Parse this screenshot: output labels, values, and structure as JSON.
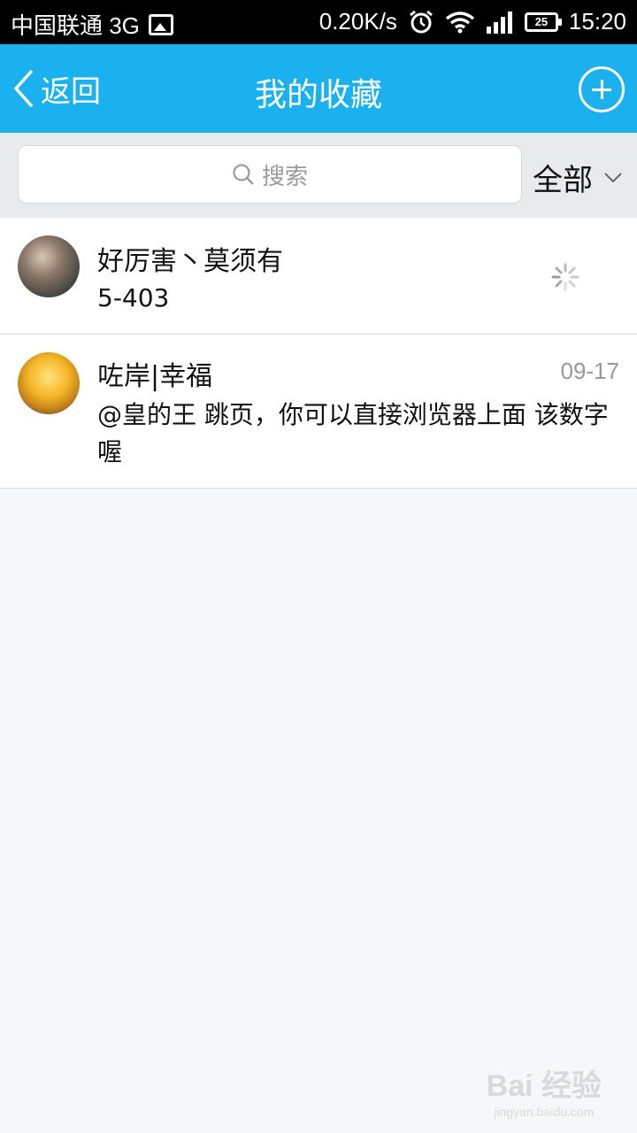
{
  "status_bar": {
    "carrier": "中国联通 3G",
    "speed": "0.20K/s",
    "battery": "25",
    "time": "15:20"
  },
  "header": {
    "back_label": "返回",
    "title": "我的收藏"
  },
  "search": {
    "placeholder": "搜索",
    "filter_label": "全部"
  },
  "items": [
    {
      "name": "好厉害丶莫须有",
      "message": "5-403",
      "time": ""
    },
    {
      "name": "咗岸|幸福",
      "message": "@皇的王  跳页，你可以直接浏览器上面 该数字喔",
      "time": "09-17"
    }
  ],
  "watermark": {
    "main": "Bai 经验",
    "sub": "jingyan.baidu.com"
  },
  "colors": {
    "accent": "#1bb1ee",
    "background": "#f6f7f9"
  }
}
